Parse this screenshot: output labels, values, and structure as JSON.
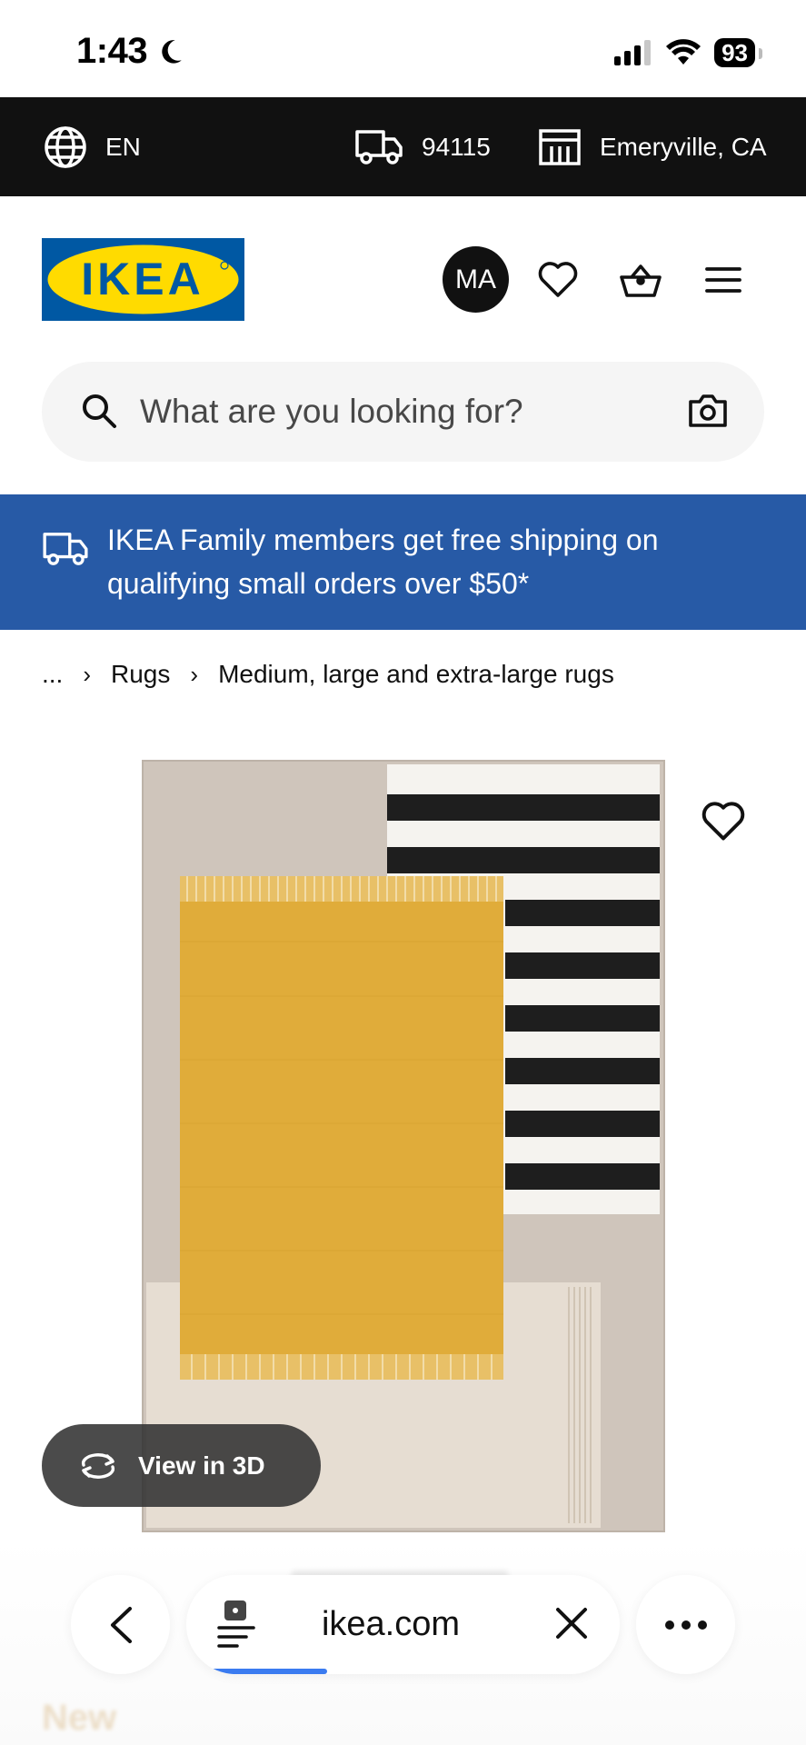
{
  "status_bar": {
    "time": "1:43",
    "battery": "93"
  },
  "utility_bar": {
    "language": "EN",
    "zip": "94115",
    "store": "Emeryville, CA"
  },
  "header": {
    "logo_text": "IKEA",
    "avatar_initials": "MA"
  },
  "search": {
    "placeholder": "What are you looking for?"
  },
  "promo": {
    "text": "IKEA Family members get free shipping on qualifying small orders over $50*"
  },
  "breadcrumb": {
    "ellipsis": "...",
    "items": [
      "Rugs",
      "Medium, large and extra-large rugs"
    ]
  },
  "product": {
    "view_3d_label": "View in 3D",
    "below_label": "New"
  },
  "browser": {
    "address": "ikea.com"
  },
  "colors": {
    "ikea_blue": "#0058a3",
    "ikea_yellow": "#ffdb00",
    "promo_blue": "#275aa6",
    "utility_black": "#111111",
    "rug_mustard": "#e0ac3a"
  }
}
